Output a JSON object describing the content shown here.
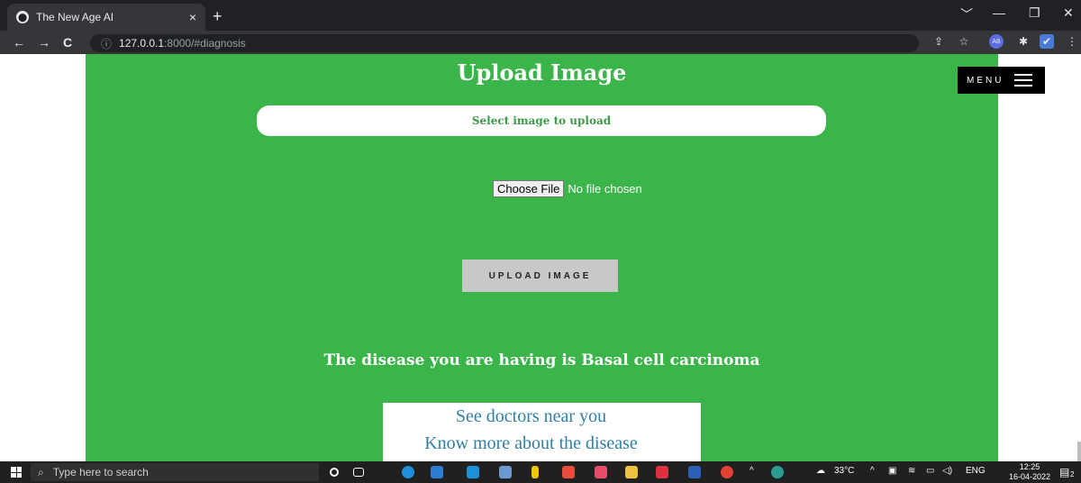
{
  "browser": {
    "tab_title": "The New Age AI",
    "tab_close": "×",
    "new_tab": "+",
    "window_controls": [
      "﹀",
      "—",
      "❐",
      "✕"
    ],
    "nav": {
      "back": "←",
      "forward": "→",
      "reload": "C"
    },
    "url_info_icon": "ⓘ",
    "url_host": "127.0.0.1",
    "url_rest": ":8000/#diagnosis",
    "ext_icons": [
      "⇪",
      "☆",
      "AB",
      "✱",
      "✔",
      "⋮"
    ]
  },
  "page": {
    "heading": "Upload Image",
    "select_label": "Select image to upload",
    "choose_file_label": "Choose File",
    "no_file_text": "No file chosen",
    "upload_button": "UPLOAD IMAGE",
    "result_text": "The disease you are having is Basal cell carcinoma",
    "link_doctors": "See doctors near you",
    "link_disease": "Know more about the disease",
    "menu_label": "MENU",
    "colors": {
      "green": "#3bb54a",
      "link": "#2f7fa6"
    }
  },
  "taskbar": {
    "search_placeholder": "Type here to search",
    "search_icon": "⌕",
    "weather": "33°C",
    "lang": "ENG",
    "time": "12:25",
    "date": "16-04-2022",
    "notif_count": "2"
  }
}
